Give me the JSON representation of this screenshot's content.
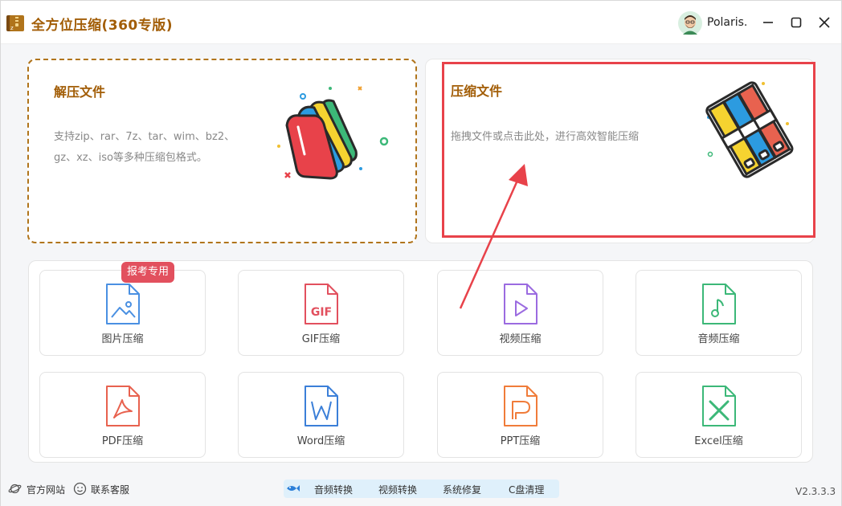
{
  "app": {
    "title": "全方位压缩(360专版)",
    "username": "Polaris."
  },
  "cards": {
    "extract": {
      "title": "解压文件",
      "description": "支持zip、rar、7z、tar、wim、bz2、gz、xz、iso等多种压缩包格式。"
    },
    "compress": {
      "title": "压缩文件",
      "description": "拖拽文件或点击此处，进行高效智能压缩"
    }
  },
  "badge": "报考专用",
  "tools": [
    {
      "label": "图片压缩",
      "icon": "image-file-icon",
      "color": "#4a90e2"
    },
    {
      "label": "GIF压缩",
      "icon": "gif-file-icon",
      "color": "#e2505e"
    },
    {
      "label": "视频压缩",
      "icon": "video-file-icon",
      "color": "#9b6be0"
    },
    {
      "label": "音频压缩",
      "icon": "audio-file-icon",
      "color": "#3cb878"
    },
    {
      "label": "PDF压缩",
      "icon": "pdf-file-icon",
      "color": "#e8624f"
    },
    {
      "label": "Word压缩",
      "icon": "word-file-icon",
      "color": "#3b7fd8"
    },
    {
      "label": "PPT压缩",
      "icon": "ppt-file-icon",
      "color": "#f07c3a"
    },
    {
      "label": "Excel压缩",
      "icon": "excel-file-icon",
      "color": "#3cb878"
    }
  ],
  "footer": {
    "website": "官方网站",
    "support": "联系客服",
    "bar_items": [
      "音频转换",
      "视频转换",
      "系统修复",
      "C盘清理"
    ],
    "version": "V2.3.3.3"
  },
  "colors": {
    "brand": "#a25d06",
    "highlight": "#e8424a",
    "badge": "#e2505e"
  }
}
